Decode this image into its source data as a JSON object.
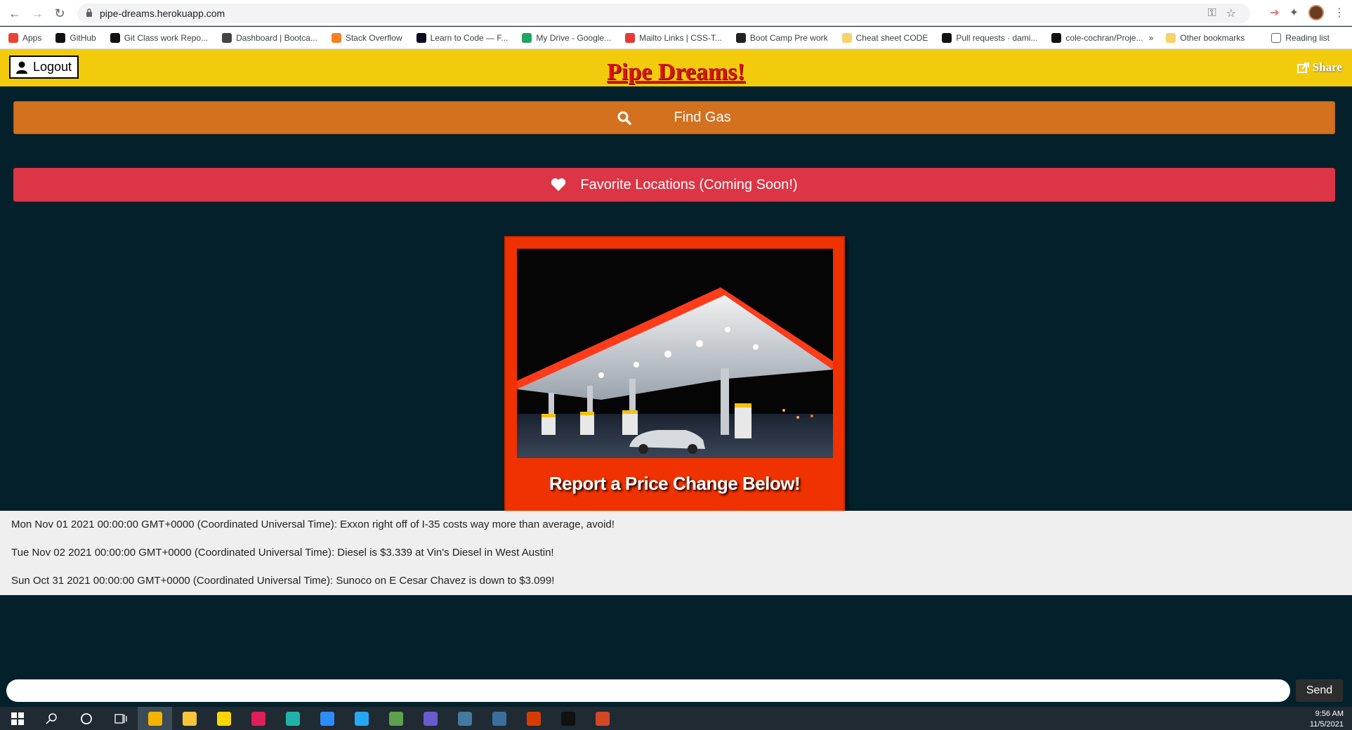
{
  "browser": {
    "url": "pipe-dreams.herokuapp.com",
    "bookmarks": [
      {
        "label": "Apps",
        "icon": "apps-grid-icon",
        "color": "#ea4335"
      },
      {
        "label": "GitHub",
        "icon": "github-icon",
        "color": "#111111"
      },
      {
        "label": "Git Class work Repo...",
        "icon": "github-icon",
        "color": "#111111"
      },
      {
        "label": "Dashboard | Bootca...",
        "icon": "globe-icon",
        "color": "#444444"
      },
      {
        "label": "Stack Overflow",
        "icon": "stackoverflow-icon",
        "color": "#f48024"
      },
      {
        "label": "Learn to Code — F...",
        "icon": "fcc-icon",
        "color": "#0a0a23"
      },
      {
        "label": "My Drive - Google...",
        "icon": "drive-icon",
        "color": "#1fa463"
      },
      {
        "label": "Mailto Links | CSS-T...",
        "icon": "asterisk-icon",
        "color": "#e53935"
      },
      {
        "label": "Boot Camp Pre work",
        "icon": "book-icon",
        "color": "#222222"
      },
      {
        "label": "Cheat sheet CODE",
        "icon": "folder-icon",
        "color": "#f6d36b"
      },
      {
        "label": "Pull requests · dami...",
        "icon": "github-icon",
        "color": "#111111"
      },
      {
        "label": "cole-cochran/Proje...",
        "icon": "github-icon",
        "color": "#111111"
      }
    ],
    "overflow_label": "»",
    "other_bookmarks": "Other bookmarks",
    "reading_list": "Reading list"
  },
  "header": {
    "logout_label": "Logout",
    "title": "Pipe Dreams!",
    "share_label": "Share"
  },
  "actions": {
    "find_gas_label": "Find Gas",
    "favorites_label": "Favorite Locations (Coming Soon!)"
  },
  "card": {
    "caption": "Report a Price Change Below!"
  },
  "messages": [
    "Mon Nov 01 2021 00:00:00 GMT+0000 (Coordinated Universal Time): Exxon right off of I-35 costs way more than average, avoid!",
    "Tue Nov 02 2021 00:00:00 GMT+0000 (Coordinated Universal Time): Diesel is $3.339 at Vin's Diesel in West Austin!",
    "Sun Oct 31 2021 00:00:00 GMT+0000 (Coordinated Universal Time): Sunoco on E Cesar Chavez is down to $3.099!"
  ],
  "chat": {
    "input_value": "",
    "send_label": "Send"
  },
  "taskbar": {
    "time": "9:56 AM",
    "date": "11/5/2021",
    "apps": [
      {
        "name": "chrome-icon",
        "color": "#f4b400",
        "active": true
      },
      {
        "name": "file-explorer-icon",
        "color": "#f8c43a",
        "active": false
      },
      {
        "name": "sticky-notes-icon",
        "color": "#ffd500",
        "active": false
      },
      {
        "name": "slack-icon",
        "color": "#e01e5a",
        "active": false
      },
      {
        "name": "git-kraken-icon",
        "color": "#20b2aa",
        "active": false
      },
      {
        "name": "zoom-icon",
        "color": "#2d8cff",
        "active": false
      },
      {
        "name": "vscode-icon",
        "color": "#23a9f2",
        "active": false
      },
      {
        "name": "node-icon",
        "color": "#5fa04e",
        "active": false
      },
      {
        "name": "eclipse-icon",
        "color": "#6a5acd",
        "active": false
      },
      {
        "name": "mysql-icon",
        "color": "#4479a1",
        "active": false
      },
      {
        "name": "workbench-icon",
        "color": "#3c6fa0",
        "active": false
      },
      {
        "name": "office-icon",
        "color": "#d83b01",
        "active": false
      },
      {
        "name": "terminal-icon",
        "color": "#111111",
        "active": false
      },
      {
        "name": "powerpoint-icon",
        "color": "#d24726",
        "active": false
      }
    ]
  }
}
